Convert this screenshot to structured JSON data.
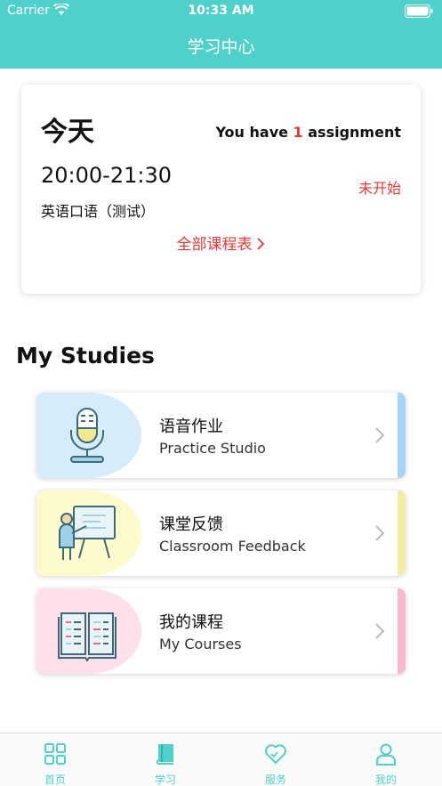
{
  "status_bar": {
    "carrier": "Carrier",
    "time": "10:33 AM"
  },
  "nav": {
    "title": "学习中心"
  },
  "today": {
    "title": "今天",
    "assignment_prefix": "You have ",
    "assignment_count": "1",
    "assignment_suffix": " assignment",
    "class_time": "20:00-21:30",
    "class_status": "未开始",
    "class_name": "英语口语（测试）",
    "schedule_link": "全部课程表"
  },
  "studies": {
    "title": "My Studies",
    "items": [
      {
        "title": "语音作业",
        "subtitle": "Practice Studio",
        "icon": "microphone-icon",
        "color": "#d6ecfa",
        "stripe": "#a9d3f5"
      },
      {
        "title": "课堂反馈",
        "subtitle": "Classroom Feedback",
        "icon": "presentation-icon",
        "color": "#fdfacb",
        "stripe": "#f3eda2"
      },
      {
        "title": "我的课程",
        "subtitle": "My Courses",
        "icon": "book-icon",
        "color": "#fde0ea",
        "stripe": "#f8b8ce"
      }
    ]
  },
  "tabs": [
    {
      "label": "首页",
      "icon": "grid-icon"
    },
    {
      "label": "学习",
      "icon": "notebook-icon",
      "active": true
    },
    {
      "label": "服务",
      "icon": "heart-icon"
    },
    {
      "label": "我的",
      "icon": "person-icon"
    }
  ],
  "colors": {
    "accent": "#4fd0cb",
    "alert": "#e53935"
  }
}
